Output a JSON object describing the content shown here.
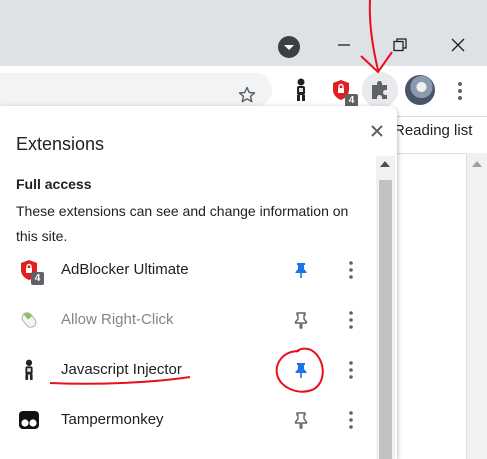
{
  "browser": {
    "window_controls": {
      "minimize": "minimize-icon",
      "restore": "restore-icon",
      "close": "close-icon"
    },
    "toolbar": {
      "bookmark_icon": "star-outline-icon",
      "extension_badge_count": "4",
      "extensions_button": "puzzle-piece-icon",
      "menu": "kebab-menu-icon"
    },
    "page_right_text": "Reading list"
  },
  "extensions_panel": {
    "title": "Extensions",
    "section_title": "Full access",
    "section_description": "These extensions can see and change information on this site.",
    "items": [
      {
        "name": "AdBlocker Ultimate",
        "icon": "adblocker-shield-icon",
        "badge": "4",
        "pinned": true,
        "enabled": true
      },
      {
        "name": "Allow Right-Click",
        "icon": "mouse-icon",
        "pinned": false,
        "enabled": false
      },
      {
        "name": "Javascript Injector",
        "icon": "injector-figure-icon",
        "pinned": true,
        "enabled": true
      },
      {
        "name": "Tampermonkey",
        "icon": "tampermonkey-icon",
        "pinned": false,
        "enabled": true
      }
    ]
  },
  "colors": {
    "accent_blue": "#1a73e8",
    "annotation_red": "#e8101c",
    "titlebar": "#dee1e6",
    "adblock_red": "#e0201e"
  }
}
